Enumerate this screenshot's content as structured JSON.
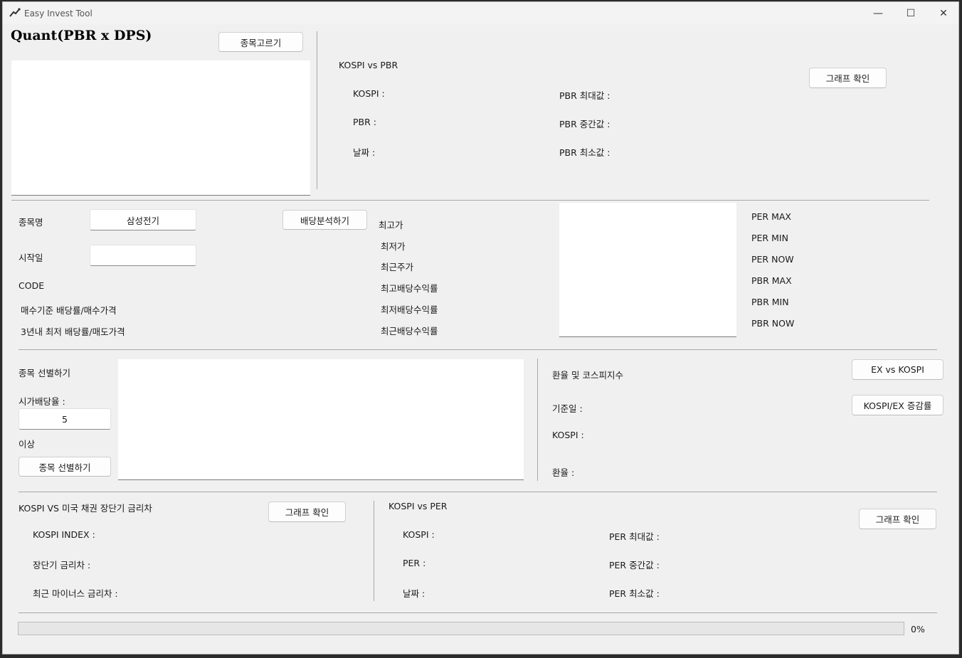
{
  "window": {
    "title": "Easy Invest Tool",
    "controls": {
      "minimize": "—",
      "maximize": "☐",
      "close": "✕"
    }
  },
  "quant": {
    "title": "Quant(PBR x DPS)",
    "pick_button": "종목고르기"
  },
  "kospi_pbr": {
    "heading": "KOSPI vs PBR",
    "graph_button": "그래프 확인",
    "kospi": "KOSPI :",
    "pbr": "PBR :",
    "date": "날짜 :",
    "pbr_max": "PBR 최대값 :",
    "pbr_mid": "PBR 중간값 :",
    "pbr_min": "PBR 최소값 :"
  },
  "dividend": {
    "name_label": "종목명",
    "name_value": "삼성전기",
    "start_label": "시작일",
    "start_value": "",
    "code_label": "CODE",
    "buy_label": "매수기준 배당률/매수가격",
    "sell_label": "3년내 최저 배당률/매도가격",
    "analyze_button": "배당분석하기",
    "high_price": "최고가",
    "low_price": "최저가",
    "recent_price": "최근주가",
    "max_yield": "최고배당수익률",
    "min_yield": "최저배당수익률",
    "recent_yield": "최근배당수익률",
    "per_max": "PER MAX",
    "per_min": "PER MIN",
    "per_now": "PER NOW",
    "pbr_max": "PBR MAX",
    "pbr_min": "PBR MIN",
    "pbr_now": "PBR NOW"
  },
  "screen": {
    "title": "종목 선별하기",
    "yield_label": "시가배당율 :",
    "yield_value": "5",
    "above_label": "이상",
    "screen_button": "종목 선별하기"
  },
  "exchange": {
    "heading": "환율 및 코스피지수",
    "base_date": "기준일 :",
    "kospi": "KOSPI :",
    "rate": "환율 :",
    "ex_button": "EX vs KOSPI",
    "change_button": "KOSPI/EX 증감률"
  },
  "bond": {
    "heading": "KOSPI VS 미국 채권 장단기 금리차",
    "graph_button": "그래프 확인",
    "kospi_index": "KOSPI INDEX :",
    "spread": "장단기 금리차 :",
    "recent_negative": "최근 마이너스 금리차 :"
  },
  "kospi_per": {
    "heading": "KOSPI vs PER",
    "graph_button": "그래프 확인",
    "kospi": "KOSPI :",
    "per": "PER :",
    "date": "날짜 :",
    "per_max": "PER 최대값 :",
    "per_mid": "PER 중간값 :",
    "per_min": "PER 최소값 :"
  },
  "progress": {
    "value": 0,
    "label": "0%"
  }
}
